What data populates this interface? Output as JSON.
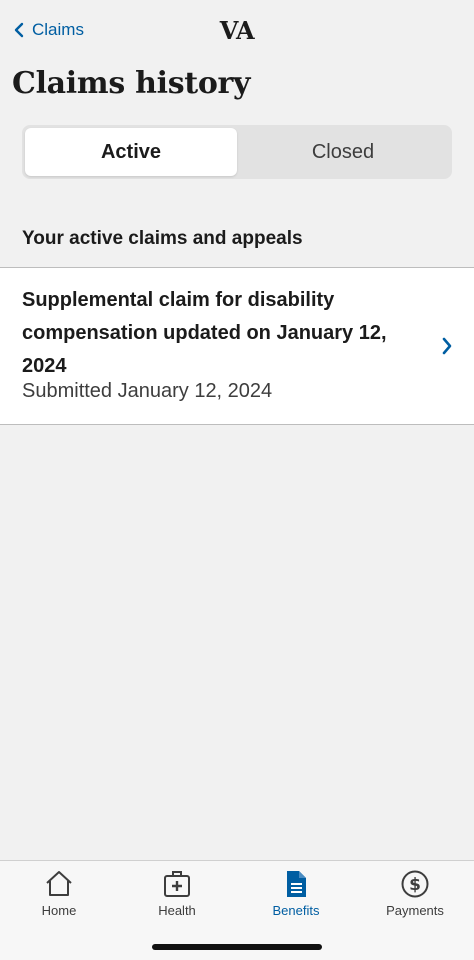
{
  "nav": {
    "back_label": "Claims",
    "logo": "VA"
  },
  "page_title": "Claims history",
  "segments": {
    "active": "Active",
    "closed": "Closed"
  },
  "section_heading": "Your active claims and appeals",
  "claims": [
    {
      "title": "Supplemental claim for disability compensation updated on January 12, 2024",
      "submitted": "Submitted January 12, 2024"
    }
  ],
  "tabs": [
    {
      "label": "Home",
      "icon": "home-icon"
    },
    {
      "label": "Health",
      "icon": "medical-kit-icon"
    },
    {
      "label": "Benefits",
      "icon": "document-icon",
      "selected": true
    },
    {
      "label": "Payments",
      "icon": "dollar-circle-icon"
    }
  ],
  "colors": {
    "accent": "#005ea2",
    "background": "#f1f1f1",
    "text": "#1b1b1b"
  }
}
